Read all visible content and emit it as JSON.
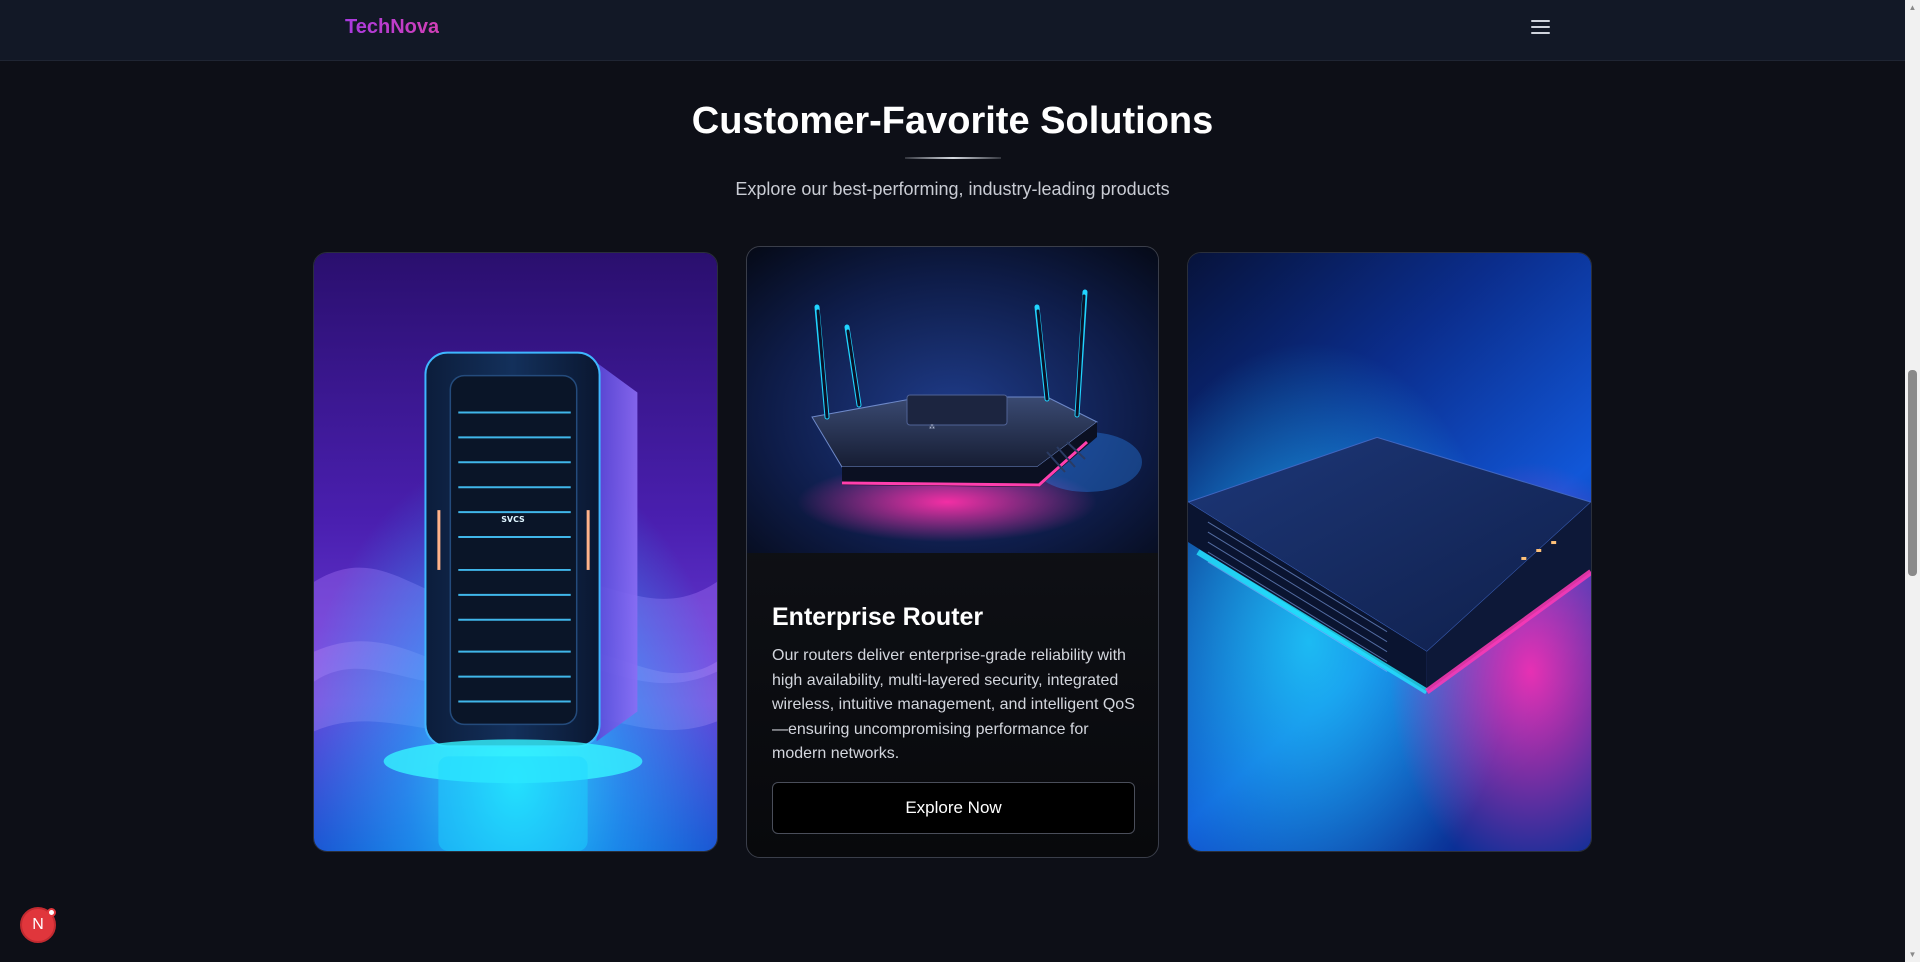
{
  "header": {
    "brand": "TechNova",
    "menu_icon": "hamburger-menu-icon"
  },
  "section": {
    "title": "Customer-Favorite Solutions",
    "subtitle": "Explore our best-performing, industry-leading products"
  },
  "cards": [
    {
      "image": "server-tower-image",
      "image_label": "SVCS"
    },
    {
      "image": "router-image",
      "title": "Enterprise Router",
      "description": "Our routers deliver enterprise-grade reliability with high availability, multi-layered security, integrated wireless, intuitive management, and intelligent QoS—ensuring uncompromising performance for modern networks.",
      "button": "Explore Now"
    },
    {
      "image": "rack-server-image"
    }
  ],
  "floating_badge": {
    "letter": "N",
    "icon": "notification-avatar-icon"
  },
  "colors": {
    "background": "#0d0f17",
    "header": "#121826",
    "brand_gradient_start": "#a93ae0",
    "brand_gradient_end": "#d23fb6",
    "badge": "#e0363c"
  }
}
